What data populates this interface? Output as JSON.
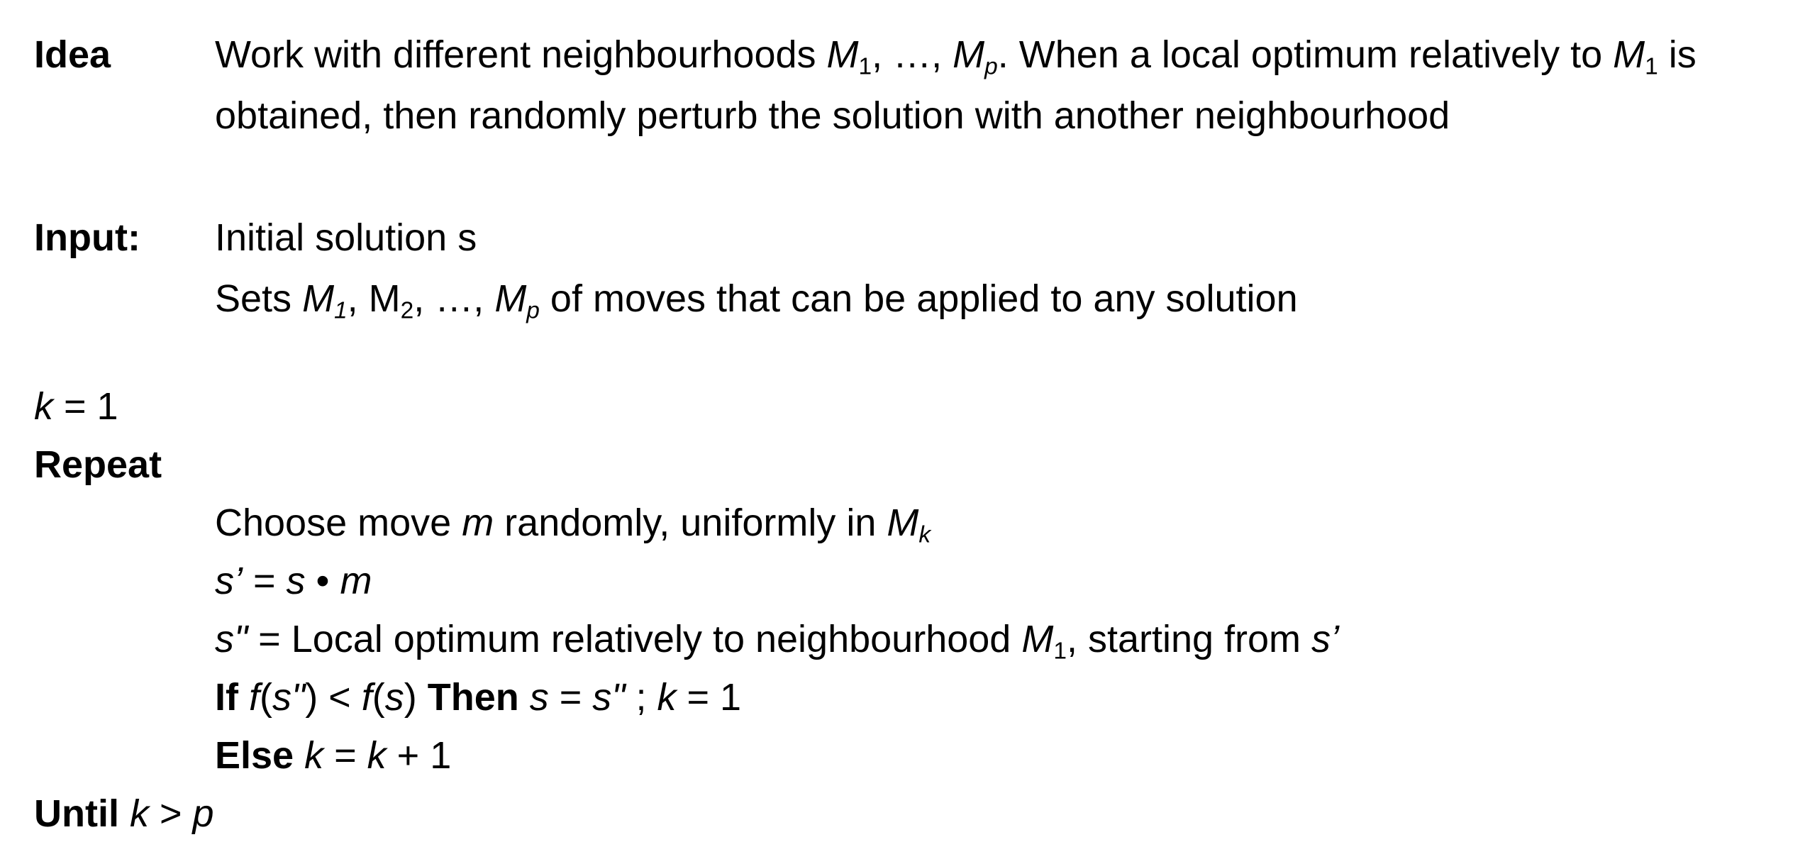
{
  "idea": {
    "label": "Idea",
    "line1": {
      "t1": "Work with different neighbourhoods ",
      "M": "M",
      "sub1": "1",
      "t2": ", …, ",
      "sub_p": "p",
      "t3": ". When a local optimum relatively to ",
      "sub_1b": "1",
      "t4": " is"
    },
    "line2": "obtained, then randomly perturb the solution with another neighbourhood"
  },
  "input": {
    "label": "Input:",
    "line1": "Initial solution s",
    "line2": {
      "t1": "Sets ",
      "M": "M",
      "sub1": "1",
      "t2": ", M",
      "sub2": "2",
      "t3": ", …, ",
      "sub_p": "p",
      "t4": " of moves that can be applied to any solution"
    }
  },
  "algorithm": {
    "init": {
      "k": "k",
      "rest": " = 1"
    },
    "repeat": "Repeat",
    "step1": {
      "t1": "Choose move ",
      "m": "m",
      "t2": " randomly, uniformly in ",
      "M": "M",
      "sub_k": "k"
    },
    "step2": {
      "s_prime": "s’",
      "eq": " = ",
      "s": "s",
      "op": " • ",
      "m": "m"
    },
    "step3": {
      "s2": "s\"",
      "t1": " = Local optimum relatively to neighbourhood ",
      "M": "M",
      "sub1": "1",
      "t2": ", starting from ",
      "s_prime": "s’"
    },
    "step4": {
      "if": "If",
      "f1": "f",
      "p1": "(",
      "s2": "s\"",
      "p2": ") < ",
      "f2": "f",
      "p3": "(",
      "s": "s",
      "p4": ") ",
      "then": "Then",
      "sp": " ",
      "s_a": "s",
      "eq": " = ",
      "s2b": "s\"",
      "semi": " ; ",
      "k": "k",
      "one": " = 1"
    },
    "step5": {
      "else": "Else",
      "sp": " ",
      "k1": "k",
      "eq": " = ",
      "k2": "k",
      "plus": " + 1"
    },
    "until": {
      "label": "Until",
      "sp": " ",
      "k": "k",
      "gt": " > ",
      "p": "p"
    }
  }
}
